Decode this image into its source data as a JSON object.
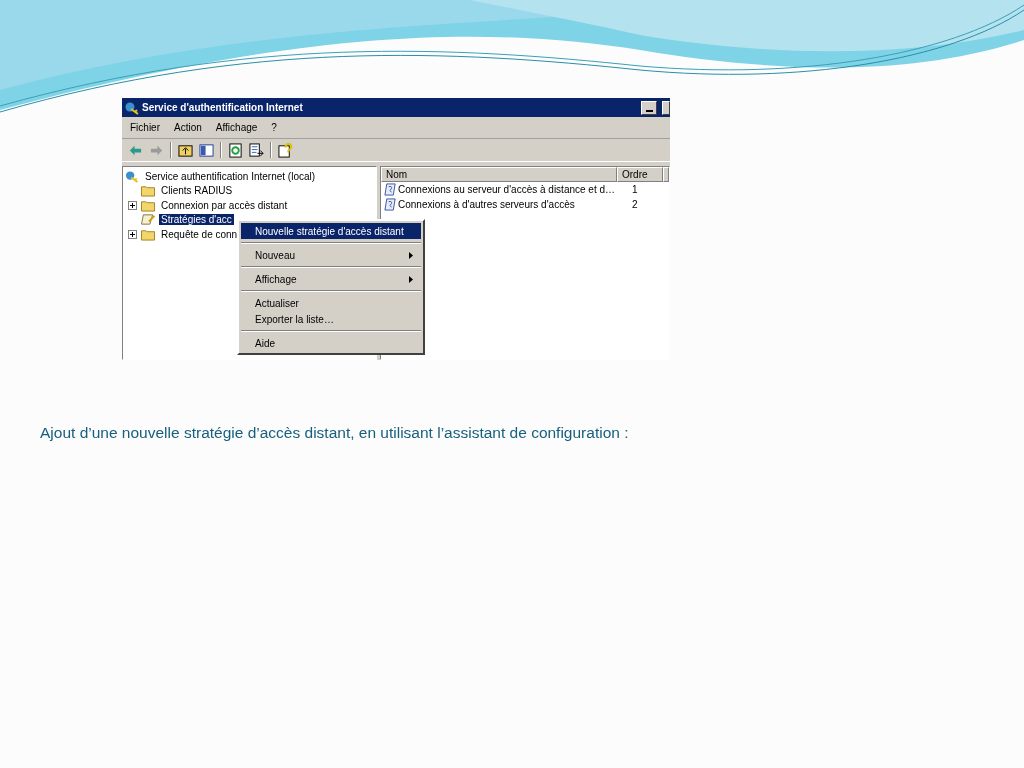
{
  "window": {
    "title": "Service d'authentification Internet"
  },
  "menu_bar": [
    "Fichier",
    "Action",
    "Affichage",
    "?"
  ],
  "tree": {
    "label": "Service authentification Internet (local)",
    "children": [
      {
        "label": "Clients RADIUS",
        "kind": "folder",
        "expandable": false,
        "selected": false
      },
      {
        "label": "Connexion par accès distant",
        "kind": "folder",
        "expandable": true,
        "selected": false
      },
      {
        "label": "Stratégies d'acc",
        "kind": "policy",
        "expandable": false,
        "selected": true
      },
      {
        "label": "Requête de conn",
        "kind": "folder",
        "expandable": true,
        "selected": false
      }
    ]
  },
  "list": {
    "columns": [
      "Nom",
      "Ordre"
    ],
    "rows": [
      {
        "name": "Connexions au serveur d'accès à distance et d…",
        "order": "1"
      },
      {
        "name": "Connexions à d'autres serveurs d'accès",
        "order": "2"
      }
    ]
  },
  "context_menu": {
    "groups": [
      [
        {
          "label": "Nouvelle stratégie d'accès distant",
          "selected": true,
          "submenu": false
        }
      ],
      [
        {
          "label": "Nouveau",
          "selected": false,
          "submenu": true
        }
      ],
      [
        {
          "label": "Affichage",
          "selected": false,
          "submenu": true
        }
      ],
      [
        {
          "label": "Actualiser",
          "selected": false,
          "submenu": false
        },
        {
          "label": "Exporter la liste…",
          "selected": false,
          "submenu": false
        }
      ],
      [
        {
          "label": "Aide",
          "selected": false,
          "submenu": false
        }
      ]
    ]
  },
  "caption": "Ajout d’une nouvelle stratégie d’accès distant, en utilisant l’assistant de configuration :"
}
